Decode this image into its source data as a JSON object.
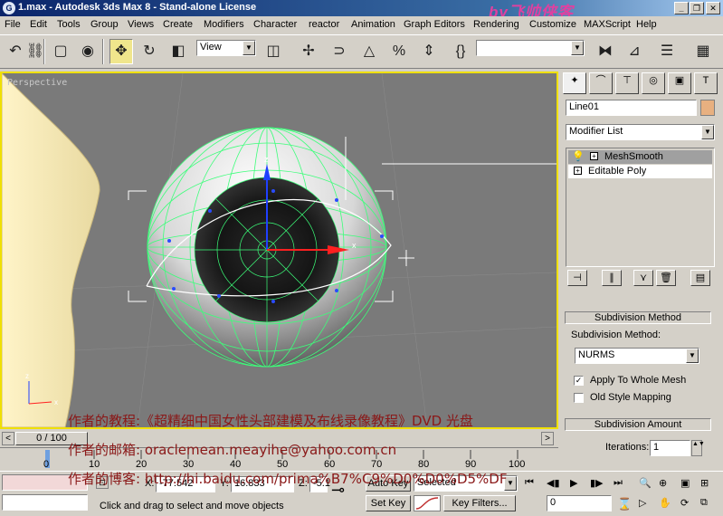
{
  "window": {
    "title": "1.max - Autodesk 3ds Max 8  - Stand-alone License",
    "logo_text": "by飞帅侠客",
    "controls": [
      "_",
      "❐",
      "✕"
    ]
  },
  "menu": [
    "File",
    "Edit",
    "Tools",
    "Group",
    "Views",
    "Create",
    "Modifiers",
    "Character",
    "reactor",
    "Animation",
    "Graph Editors",
    "Rendering",
    "Customize",
    "MAXScript",
    "Help"
  ],
  "toolbar": {
    "view_dropdown": "View"
  },
  "viewport": {
    "label": "Perspective",
    "axis_x": "x",
    "axis_z": "z",
    "axis_y": "y"
  },
  "overlay": {
    "line1": "作者的教程:《超精细中国女性头部建模及布线录像教程》DVD 光盘",
    "line2": "作者的邮箱: oraclemean.meayihe@yahoo.com.cn",
    "line3": "作者的博客: http://hi.baidu.com/prima%B7%C9%D0%D0%D5%DF"
  },
  "command_panel": {
    "object_name": "Line01",
    "modifier_list": "Modifier List",
    "stack": [
      "MeshSmooth",
      "Editable Poly"
    ],
    "rollout1": {
      "title": "Subdivision Method",
      "method_label": "Subdivision Method:",
      "method_value": "NURMS",
      "apply_whole_mesh": "Apply To Whole Mesh",
      "apply_whole_mesh_checked": true,
      "old_style_mapping": "Old Style Mapping",
      "old_style_mapping_checked": false
    },
    "rollout2": {
      "title": "Subdivision Amount",
      "iterations_label": "Iterations:",
      "iterations_value": "1"
    }
  },
  "timeline": {
    "frame_counter": "0 / 100",
    "ticks": [
      "0",
      "10",
      "20",
      "30",
      "40",
      "50",
      "60",
      "70",
      "80",
      "90",
      "100"
    ]
  },
  "status": {
    "x_label": "X:",
    "x_value": "-77.542",
    "y_label": "Y:",
    "y_value": "16.833",
    "z_label": "Z:",
    "z_value": "-5.1",
    "auto_key": "Auto Key",
    "selected": "Selected",
    "set_key": "Set Key",
    "key_filters": "Key Filters...",
    "frame_value": "0",
    "prompt": "Click and drag to select and move objects"
  },
  "colors": {
    "viewport_border": "#f0e000",
    "mesh_wire": "#3cff7a",
    "overlay_text": "#8a1818"
  }
}
